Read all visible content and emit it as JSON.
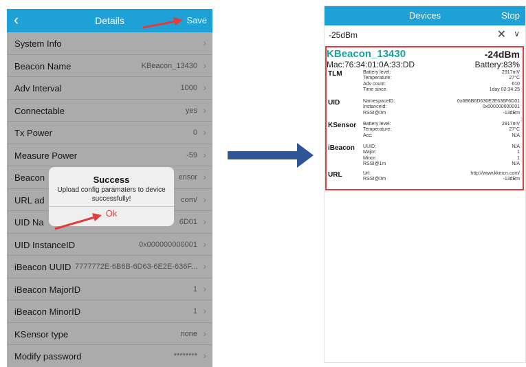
{
  "left_screen": {
    "nav": {
      "back_icon": "chevron-left-icon",
      "back_glyph": "‹",
      "title": "Details",
      "save_label": "Save"
    },
    "rows": [
      {
        "label": "System Info",
        "value": ""
      },
      {
        "label": "Beacon Name",
        "value": "KBeacon_13430"
      },
      {
        "label": "Adv Interval",
        "value": "1000"
      },
      {
        "label": "Connectable",
        "value": "yes"
      },
      {
        "label": "Tx Power",
        "value": "0"
      },
      {
        "label": "Measure Power",
        "value": "-59"
      },
      {
        "label": "Beacon",
        "value": "ensor"
      },
      {
        "label": "URL ad",
        "value": "com/"
      },
      {
        "label": "UID Na",
        "value": "6D01"
      },
      {
        "label": "UID InstanceID",
        "value": "0x000000000001"
      },
      {
        "label": "iBeacon UUID",
        "value": "7777772E-6B6B-6D63-6E2E-636F..."
      },
      {
        "label": "iBeacon MajorID",
        "value": "1"
      },
      {
        "label": "iBeacon MinorID",
        "value": "1"
      },
      {
        "label": "KSensor type",
        "value": "none"
      },
      {
        "label": "Modify password",
        "value": "********"
      }
    ],
    "chevron_glyph": "›",
    "alert": {
      "title": "Success",
      "message": "Upload config paramaters to device successfully!",
      "ok_label": "Ok"
    }
  },
  "right_screen": {
    "nav": {
      "title": "Devices",
      "stop_label": "Stop"
    },
    "filter": {
      "rssi_value": "-25dBm",
      "clear_glyph": "✕",
      "expand_glyph": "∨"
    },
    "device": {
      "name": "KBeacon_13430",
      "rssi": "-24dBm",
      "mac": "Mac:76:34:01:0A:33:DD",
      "battery": "Battery:83%",
      "chevron_glyph": "›",
      "sections": [
        {
          "name": "TLM",
          "fields": [
            {
              "key": "Battery level:",
              "value": "2917mV"
            },
            {
              "key": "Temperature:",
              "value": "27°C"
            },
            {
              "key": "Adv count:",
              "value": "610"
            },
            {
              "key": "Time since",
              "value": "1day 02:34:25"
            }
          ]
        },
        {
          "name": "UID",
          "fields": [
            {
              "key": "NamespaceID:",
              "value": "0x6B6B6D636E2E636F6D01"
            },
            {
              "key": "InstanceId:",
              "value": "0x000000000001"
            },
            {
              "key": "RSSI@0m",
              "value": "-13dBm"
            }
          ]
        },
        {
          "name": "KSensor",
          "fields": [
            {
              "key": "Battery level:",
              "value": "2917mV"
            },
            {
              "key": "Temperature:",
              "value": "27°C"
            },
            {
              "key": "Acc:",
              "value": "N/A"
            }
          ]
        },
        {
          "name": "iBeacon",
          "fields": [
            {
              "key": "UUID:",
              "value": "N/A"
            },
            {
              "key": "Major:",
              "value": "1"
            },
            {
              "key": "Minor:",
              "value": "1"
            },
            {
              "key": "RSSI@1m",
              "value": "N/A"
            }
          ]
        },
        {
          "name": "URL",
          "fields": [
            {
              "key": "Url:",
              "value": "http://www.kkmcn.com/"
            },
            {
              "key": "RSSI@0m",
              "value": "-13dBm"
            }
          ]
        }
      ]
    }
  },
  "colors": {
    "nav_blue": "#1ea1d6",
    "highlight_red": "#e53a3a",
    "device_name_teal": "#1aa39a",
    "arrow_blue": "#2f5597"
  }
}
